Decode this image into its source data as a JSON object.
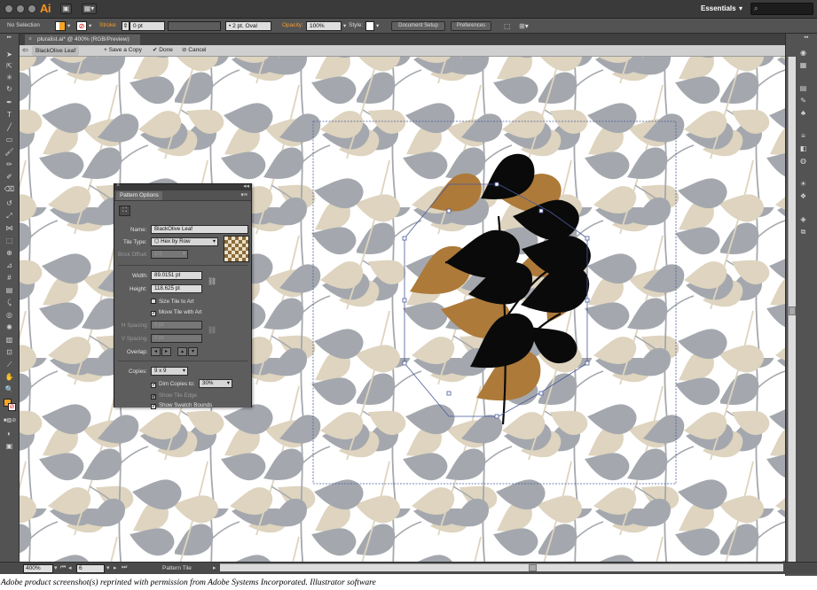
{
  "app": {
    "logo": "Ai",
    "workspace": "Essentials"
  },
  "control_bar": {
    "selection_label": "No Selection",
    "stroke_label": "Stroke",
    "stroke_value": "0 pt",
    "brush_value": "2 pt. Oval",
    "opacity_label": "Opacity:",
    "opacity_value": "100%",
    "style_label": "Style:",
    "document_setup": "Document Setup",
    "preferences": "Preferences"
  },
  "document": {
    "tab_title": "pluralist.ai* @ 400% (RGB/Preview)"
  },
  "isolation_bar": {
    "pattern_name": "BlackOlive Leaf",
    "save_copy": "Save a Copy",
    "done": "Done",
    "cancel": "Cancel"
  },
  "pattern_panel": {
    "title": "Pattern Options",
    "name_label": "Name:",
    "name_value": "BlackOlive Leaf",
    "tile_type_label": "Tile Type:",
    "tile_type_value": "Hex by Row",
    "brick_offset_label": "Brick Offset:",
    "brick_offset_value": "1/2",
    "width_label": "Width:",
    "width_value": "89.0151 pt",
    "height_label": "Height:",
    "height_value": "118.625 pt",
    "size_tile_to_art": "Size Tile to Art",
    "move_tile_with_art": "Move Tile with Art",
    "h_spacing_label": "H Spacing:",
    "h_spacing_value": "0 pt",
    "v_spacing_label": "V Spacing:",
    "v_spacing_value": "0 pt",
    "overlap_label": "Overlap:",
    "copies_label": "Copies:",
    "copies_value": "9 x 9",
    "dim_copies_label": "Dim Copies to:",
    "dim_copies_value": "30%",
    "show_tile_edge": "Show Tile Edge",
    "show_swatch_bounds": "Show Swatch Bounds"
  },
  "status_bar": {
    "zoom": "400%",
    "page": "6",
    "status": "Pattern Tile"
  },
  "caption": "Adobe product screenshot(s) reprinted with permission from Adobe Systems Incorporated. Illustrator software",
  "colors": {
    "tan_leaf_dim": "#ded4bf",
    "gray_leaf_dim": "#a4a8ae",
    "brown_leaf": "#ad7a3a",
    "black_leaf": "#0a0a0a",
    "accent_orange": "#f79c2a"
  },
  "icons": [
    "close-icon",
    "minimize-icon",
    "zoom-icon",
    "search-icon",
    "back-arrow-icon",
    "checkmark-icon",
    "cancel-icon"
  ]
}
